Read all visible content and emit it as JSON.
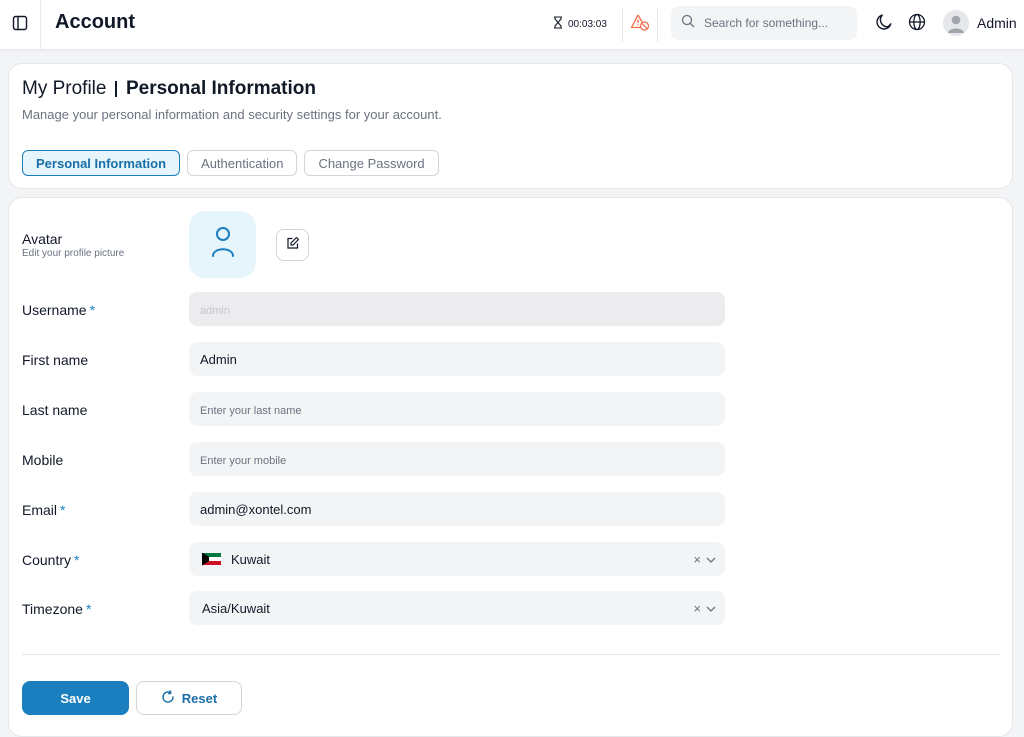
{
  "topbar": {
    "title": "Account",
    "timer": "00:03:03",
    "search_placeholder": "Search for something...",
    "user_name": "Admin"
  },
  "header": {
    "title": "My Profile",
    "subtitle": "Personal Information",
    "description": "Manage your personal information and security settings for your account.",
    "tabs": [
      {
        "label": "Personal Information",
        "active": true
      },
      {
        "label": "Authentication",
        "active": false
      },
      {
        "label": "Change Password",
        "active": false
      }
    ]
  },
  "form": {
    "avatar": {
      "label": "Avatar",
      "hint": "Edit your profile picture"
    },
    "username": {
      "label": "Username",
      "required": "*",
      "value": "",
      "placeholder": "admin"
    },
    "first_name": {
      "label": "First name",
      "value": "Admin"
    },
    "last_name": {
      "label": "Last name",
      "value": "",
      "placeholder": "Enter your last name"
    },
    "mobile": {
      "label": "Mobile",
      "value": "",
      "placeholder": "Enter your mobile"
    },
    "email": {
      "label": "Email",
      "required": "*",
      "value": "admin@xontel.com"
    },
    "country": {
      "label": "Country",
      "required": "*",
      "value": "Kuwait"
    },
    "timezone": {
      "label": "Timezone",
      "required": "*",
      "value": "Asia/Kuwait"
    },
    "clear_symbol": "×"
  },
  "actions": {
    "save_label": "Save",
    "reset_label": "Reset"
  },
  "colors": {
    "accent": "#1a7ebf",
    "alert": "#f06a4a"
  }
}
